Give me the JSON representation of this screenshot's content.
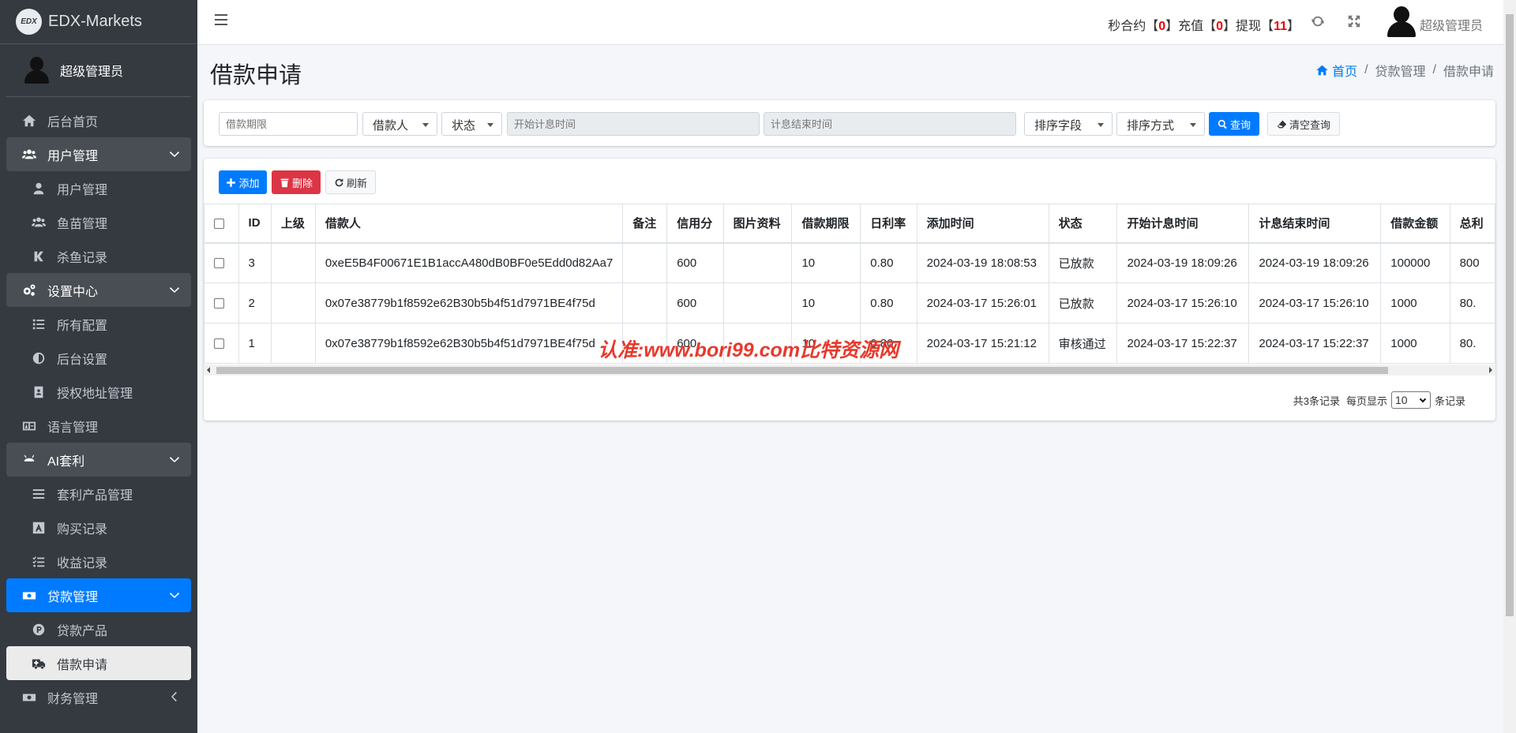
{
  "app": {
    "brand": "EDX-Markets",
    "logo_text": "EDX"
  },
  "sidebar": {
    "user": "超级管理员",
    "items": [
      {
        "label": "后台首页",
        "icon": "home-icon"
      },
      {
        "label": "用户管理",
        "icon": "users-icon"
      },
      {
        "label": "用户管理",
        "icon": "user-icon"
      },
      {
        "label": "鱼苗管理",
        "icon": "users-icon"
      },
      {
        "label": "杀鱼记录",
        "icon": "k-icon"
      },
      {
        "label": "设置中心",
        "icon": "cogs-icon"
      },
      {
        "label": "所有配置",
        "icon": "list-icon"
      },
      {
        "label": "后台设置",
        "icon": "adjust-icon"
      },
      {
        "label": "授权地址管理",
        "icon": "address-book-icon"
      },
      {
        "label": "语言管理",
        "icon": "language-icon"
      },
      {
        "label": "AI套利",
        "icon": "android-icon"
      },
      {
        "label": "套利产品管理",
        "icon": "bars-icon"
      },
      {
        "label": "购买记录",
        "icon": "font-icon"
      },
      {
        "label": "收益记录",
        "icon": "tasks-icon"
      },
      {
        "label": "贷款管理",
        "icon": "money-icon"
      },
      {
        "label": "贷款产品",
        "icon": "product-icon"
      },
      {
        "label": "借款申请",
        "icon": "ambulance-icon"
      },
      {
        "label": "财务管理",
        "icon": "money-icon"
      }
    ]
  },
  "navbar": {
    "stat_a_label": "秒合约【",
    "stat_a_value": "0",
    "stat_b_label": "】充值【",
    "stat_b_value": "0",
    "stat_c_label": "】提现【",
    "stat_c_value": "11",
    "stat_end": "】",
    "user": "超级管理员"
  },
  "page": {
    "title": "借款申请",
    "breadcrumb": {
      "home": "首页",
      "parent": "贷款管理",
      "current": "借款申请"
    }
  },
  "filters": {
    "period_placeholder": "借款期限",
    "borrower": "借款人",
    "status": "状态",
    "start_placeholder": "开始计息时间",
    "end_placeholder": "计息结束时间",
    "sort_field": "排序字段",
    "sort_order": "排序方式",
    "query_label": "查询",
    "clear_label": "清空查询"
  },
  "toolbar": {
    "add_label": "添加",
    "delete_label": "删除",
    "refresh_label": "刷新"
  },
  "table": {
    "headers": [
      "ID",
      "上级",
      "借款人",
      "备注",
      "信用分",
      "图片资料",
      "借款期限",
      "日利率",
      "添加时间",
      "状态",
      "开始计息时间",
      "计息结束时间",
      "借款金额",
      "总利"
    ],
    "rows": [
      [
        "3",
        "",
        "0xeE5B4F00671E1B1accA480dB0BF0e5Edd0d82Aa7",
        "",
        "600",
        "",
        "10",
        "0.80",
        "2024-03-19 18:08:53",
        "已放款",
        "2024-03-19 18:09:26",
        "2024-03-19 18:09:26",
        "100000",
        "800"
      ],
      [
        "2",
        "",
        "0x07e38779b1f8592e62B30b5b4f51d7971BE4f75d",
        "",
        "600",
        "",
        "10",
        "0.80",
        "2024-03-17 15:26:01",
        "已放款",
        "2024-03-17 15:26:10",
        "2024-03-17 15:26:10",
        "1000",
        "80."
      ],
      [
        "1",
        "",
        "0x07e38779b1f8592e62B30b5b4f51d7971BE4f75d",
        "",
        "600",
        "",
        "10",
        "0.80",
        "2024-03-17 15:21:12",
        "审核通过",
        "2024-03-17 15:22:37",
        "2024-03-17 15:22:37",
        "1000",
        "80."
      ]
    ]
  },
  "pager": {
    "total": "共3条记录",
    "per_page_label": "每页显示",
    "per_page": "10",
    "unit": "条记录"
  },
  "watermark": "认准:www.bori99.com比特资源网",
  "colors": {
    "primary": "#007bff",
    "danger": "#dc3545",
    "sidebar": "#343a40",
    "stat_red": "#ee0000"
  }
}
